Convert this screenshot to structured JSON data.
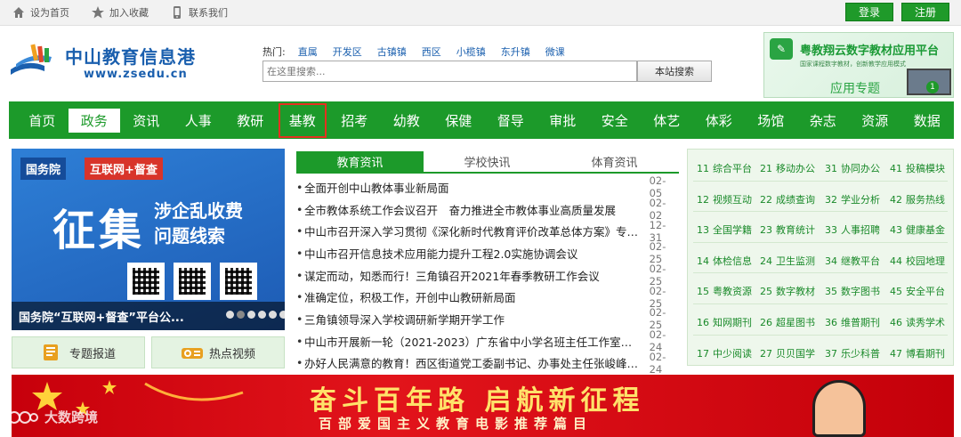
{
  "topbar": {
    "links": [
      {
        "label": "设为首页",
        "icon": "home-icon"
      },
      {
        "label": "加入收藏",
        "icon": "star-icon"
      },
      {
        "label": "联系我们",
        "icon": "phone-icon"
      }
    ],
    "login": "登录",
    "register": "注册"
  },
  "logo": {
    "cn": "中山教育信息港",
    "en": "www.zsedu.cn"
  },
  "hot": {
    "label": "热门:",
    "links": [
      "直属",
      "开发区",
      "古镇镇",
      "西区",
      "小榄镇",
      "东升镇",
      "微课"
    ]
  },
  "search": {
    "placeholder": "在这里搜索...",
    "button": "本站搜索"
  },
  "ad_top": {
    "title": "粤教翔云数字教材应用平台",
    "subtitle": "国家课程数字教材，创新教学应用模式",
    "cta": "应用专题",
    "badge": "1"
  },
  "nav": {
    "items": [
      "首页",
      "政务",
      "资讯",
      "人事",
      "教研",
      "基教",
      "招考",
      "幼教",
      "保健",
      "督导",
      "审批",
      "安全",
      "体艺",
      "体彩",
      "场馆",
      "杂志",
      "资源",
      "数据"
    ],
    "active_index": 1,
    "highlight_index": 5
  },
  "banner": {
    "tag1": "国务院",
    "tag2": "互联网+督查",
    "big": "征集",
    "sub1": "涉企乱收费",
    "sub2": "问题线索",
    "caption": "国务院“互联网+督查”平台公...",
    "slide_count": 6,
    "current_slide": 1
  },
  "quick_buttons": [
    {
      "label": "专题报道",
      "icon": "book-icon"
    },
    {
      "label": "热点视频",
      "icon": "projector-icon"
    }
  ],
  "news": {
    "tabs": [
      "教育资讯",
      "学校快讯",
      "体育资讯"
    ],
    "active_tab": 0,
    "items": [
      {
        "title": "全面开创中山教体事业新局面",
        "date": "02-05"
      },
      {
        "title": "全市教体系统工作会议召开　奋力推进全市教体事业高质量发展",
        "date": "02-02"
      },
      {
        "title": "中山市召开深入学习贯彻《深化新时代教育评价改革总体方案》专题会议",
        "date": "12-31"
      },
      {
        "title": "中山市召开信息技术应用能力提升工程2.0实施协调会议",
        "date": "02-25"
      },
      {
        "title": "谋定而动，知悉而行！三角镇召开2021年春季教研工作会议",
        "date": "02-25"
      },
      {
        "title": "准确定位，积极工作，开创中山教研新局面",
        "date": "02-25"
      },
      {
        "title": "三角镇领导深入学校调研新学期开学工作",
        "date": "02-25"
      },
      {
        "title": "中山市开展新一轮（2021-2023）广东省中小学名班主任工作室主持人评选",
        "date": "02-24"
      },
      {
        "title": "办好人民满意的教育！西区街道党工委副书记、办事处主任张峻峰调研学校工作",
        "date": "02-24"
      }
    ]
  },
  "services": {
    "columns": [
      [
        {
          "n": "11",
          "label": "综合平台"
        },
        {
          "n": "12",
          "label": "视频互动"
        },
        {
          "n": "13",
          "label": "全国学籍"
        },
        {
          "n": "14",
          "label": "体检信息"
        },
        {
          "n": "15",
          "label": "粤教资源"
        },
        {
          "n": "16",
          "label": "知网期刊"
        },
        {
          "n": "17",
          "label": "中少阅读"
        }
      ],
      [
        {
          "n": "21",
          "label": "移动办公"
        },
        {
          "n": "22",
          "label": "成绩查询"
        },
        {
          "n": "23",
          "label": "教育统计"
        },
        {
          "n": "24",
          "label": "卫生监测"
        },
        {
          "n": "25",
          "label": "数字教材"
        },
        {
          "n": "26",
          "label": "超星图书"
        },
        {
          "n": "27",
          "label": "贝贝国学"
        }
      ],
      [
        {
          "n": "31",
          "label": "协同办公"
        },
        {
          "n": "32",
          "label": "学业分析"
        },
        {
          "n": "33",
          "label": "人事招聘"
        },
        {
          "n": "34",
          "label": "继教平台"
        },
        {
          "n": "35",
          "label": "数字图书"
        },
        {
          "n": "36",
          "label": "维普期刊"
        },
        {
          "n": "37",
          "label": "乐少科普"
        }
      ],
      [
        {
          "n": "41",
          "label": "投稿模块"
        },
        {
          "n": "42",
          "label": "服务热线"
        },
        {
          "n": "43",
          "label": "健康基金"
        },
        {
          "n": "44",
          "label": "校园地理"
        },
        {
          "n": "45",
          "label": "安全平台"
        },
        {
          "n": "46",
          "label": "读秀学术"
        },
        {
          "n": "47",
          "label": "博看期刊"
        }
      ]
    ]
  },
  "bottom_banner": {
    "title": "奋斗百年路 启航新征程",
    "subtitle": "百部爱国主义教育电影推荐篇目"
  },
  "watermark": {
    "text": "大数跨境"
  },
  "colors": {
    "brand_green": "#1c9a2a",
    "brand_blue": "#1a5fae",
    "banner_red": "#d20a12",
    "highlight_red": "#e53020"
  }
}
